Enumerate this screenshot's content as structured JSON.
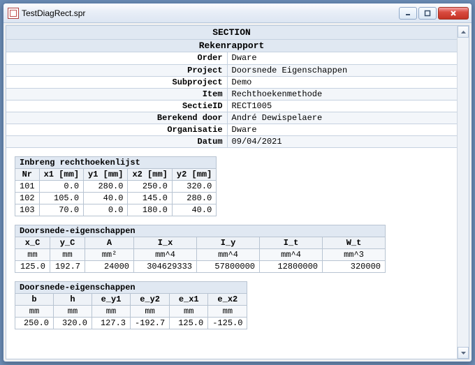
{
  "window": {
    "title": "TestDiagRect.spr"
  },
  "headings": {
    "section": "SECTION",
    "report": "Rekenrapport"
  },
  "meta": {
    "labels": [
      "Order",
      "Project",
      "Subproject",
      "Item",
      "SectieID",
      "Berekend door",
      "Organisatie",
      "Datum"
    ],
    "values": [
      "Dware",
      "Doorsnede Eigenschappen",
      "Demo",
      "Rechthoekenmethode",
      "RECT1005",
      "André Dewispelaere",
      "Dware",
      "09/04/2021"
    ]
  },
  "table1": {
    "caption": "Inbreng rechthoekenlijst",
    "headers": [
      "Nr",
      "x1 [mm]",
      "y1 [mm]",
      "x2 [mm]",
      "y2 [mm]"
    ],
    "rows": [
      [
        "101",
        "0.0",
        "280.0",
        "250.0",
        "320.0"
      ],
      [
        "102",
        "105.0",
        "40.0",
        "145.0",
        "280.0"
      ],
      [
        "103",
        "70.0",
        "0.0",
        "180.0",
        "40.0"
      ]
    ]
  },
  "table2": {
    "caption": "Doorsnede-eigenschappen",
    "headers": [
      "x_C",
      "y_C",
      "A",
      "I_x",
      "I_y",
      "I_t",
      "W_t"
    ],
    "units": [
      "mm",
      "mm",
      "mm²",
      "mm^4",
      "mm^4",
      "mm^4",
      "mm^3"
    ],
    "row": [
      "125.0",
      "192.7",
      "24000",
      "304629333",
      "57800000",
      "12800000",
      "320000"
    ]
  },
  "table3": {
    "caption": "Doorsnede-eigenschappen",
    "headers": [
      "b",
      "h",
      "e_y1",
      "e_y2",
      "e_x1",
      "e_x2"
    ],
    "units": [
      "mm",
      "mm",
      "mm",
      "mm",
      "mm",
      "mm"
    ],
    "row": [
      "250.0",
      "320.0",
      "127.3",
      "-192.7",
      "125.0",
      "-125.0"
    ]
  }
}
